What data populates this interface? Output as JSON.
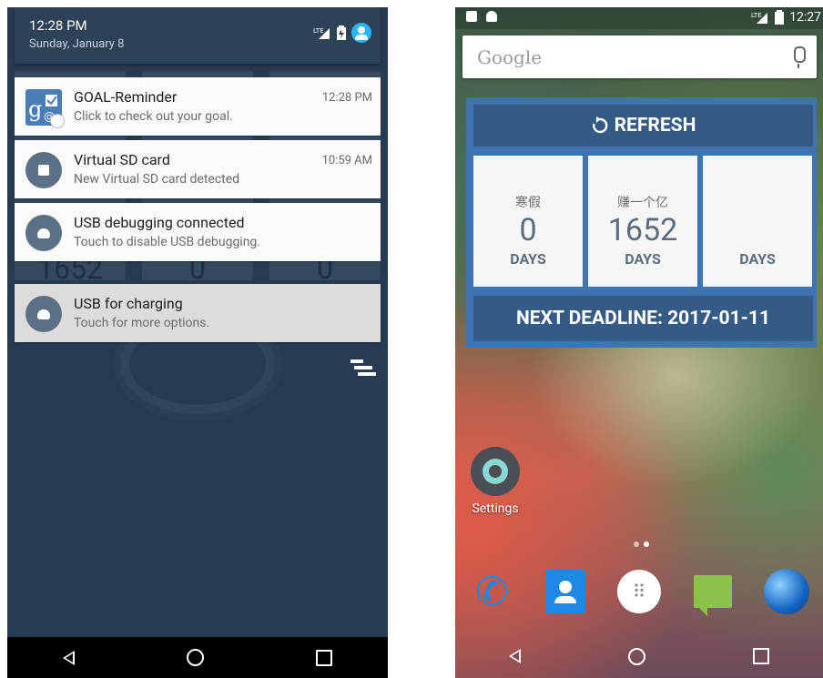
{
  "left": {
    "header": {
      "time": "12:28 PM",
      "date": "Sunday, January 8"
    },
    "background_tiles": [
      "1652",
      "0",
      "0"
    ],
    "notifications": [
      {
        "title": "GOAL-Reminder",
        "text": "Click to check out your goal.",
        "time": "12:28 PM"
      },
      {
        "title": "Virtual SD card",
        "text": "New Virtual SD card detected",
        "time": "10:59 AM"
      },
      {
        "title": "USB debugging connected",
        "text": "Touch to disable USB debugging.",
        "time": ""
      },
      {
        "title": "USB for charging",
        "text": "Touch for more options.",
        "time": ""
      }
    ]
  },
  "right": {
    "status_time": "12:27",
    "search_placeholder": "Google",
    "widget": {
      "refresh_label": "REFRESH",
      "goals": [
        {
          "label": "寒假",
          "value": "0",
          "unit": "DAYS"
        },
        {
          "label": "赚一个亿",
          "value": "1652",
          "unit": "DAYS"
        },
        {
          "label": "",
          "value": "",
          "unit": "DAYS"
        }
      ],
      "deadline": "NEXT DEADLINE: 2017-01-11"
    },
    "desktop_app": "Settings",
    "dock": [
      "phone-icon",
      "contacts-icon",
      "app-drawer-icon",
      "messenger-icon",
      "browser-icon"
    ]
  },
  "colors": {
    "shade_bg": "#263b53",
    "widget_blue": "#3f74b0",
    "widget_dark": "#335b86"
  }
}
